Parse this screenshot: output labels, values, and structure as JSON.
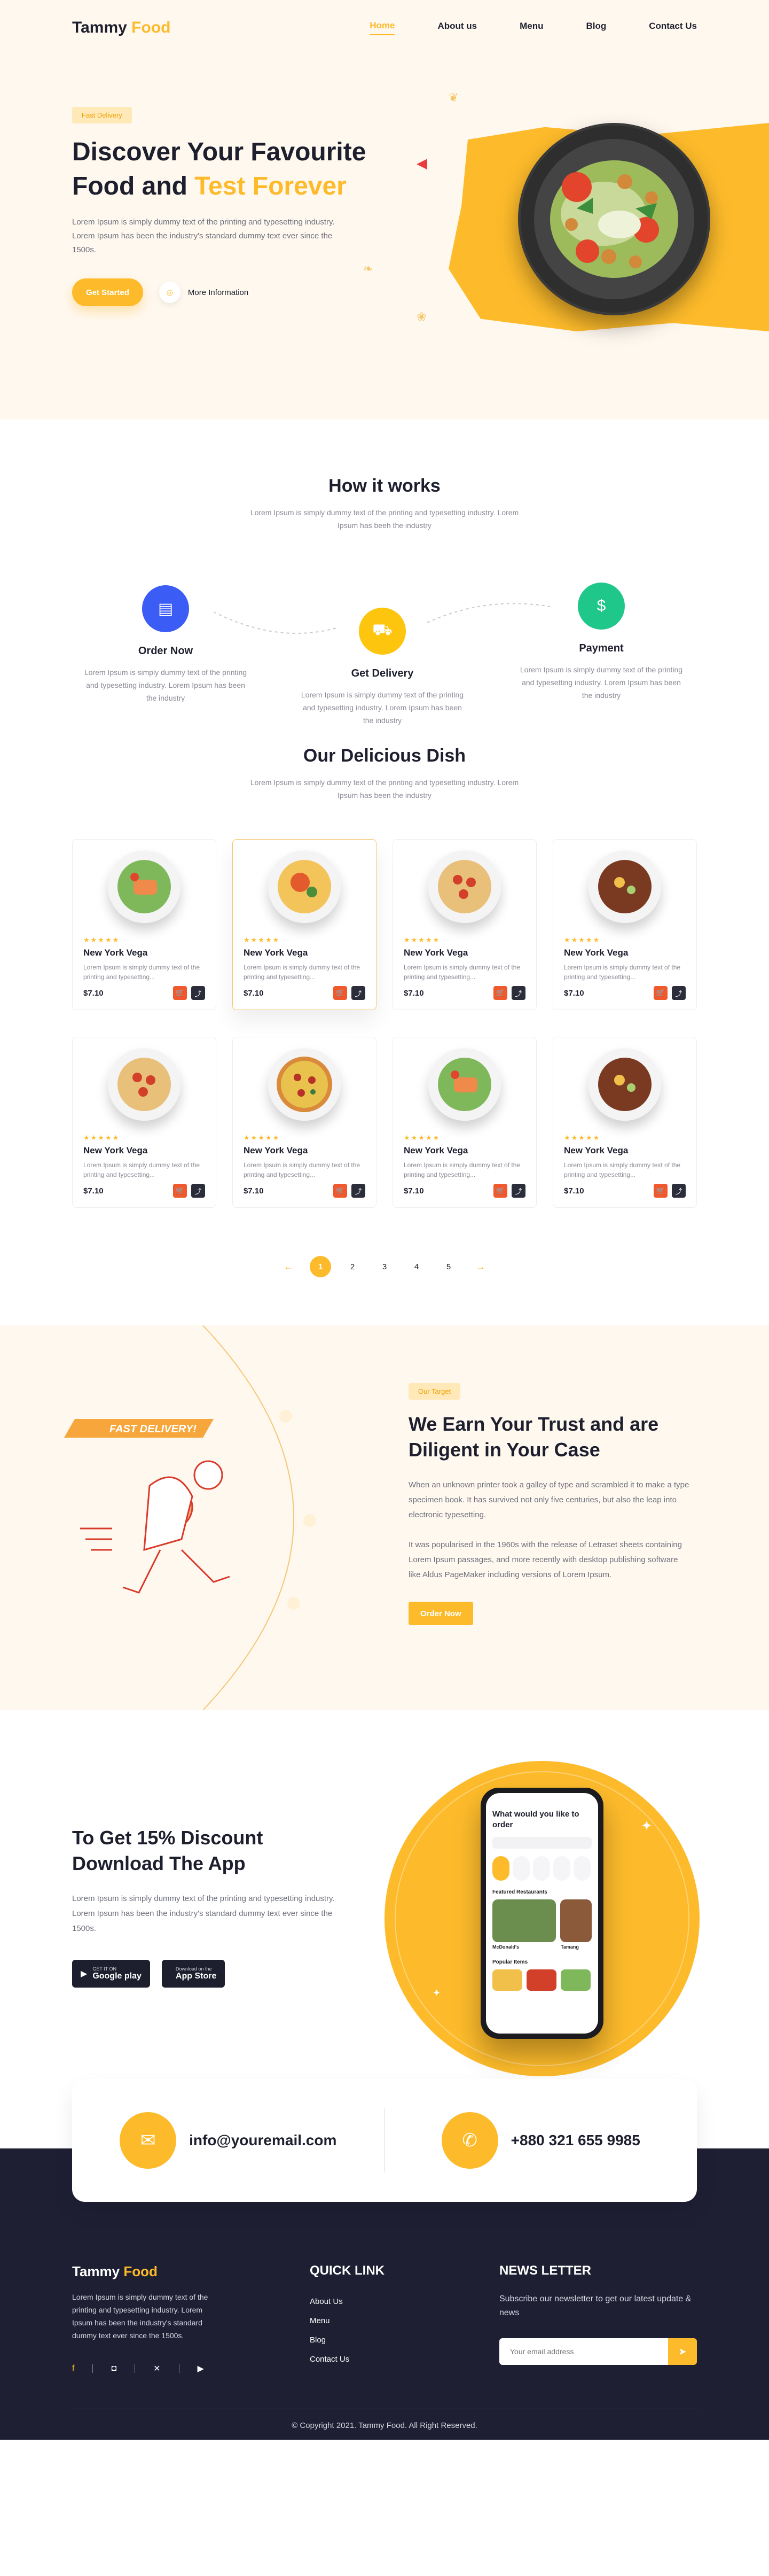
{
  "header": {
    "logo_main": "Tammy",
    "logo_accent": "Food",
    "nav": [
      {
        "label": "Home",
        "active": true
      },
      {
        "label": "About us",
        "active": false
      },
      {
        "label": "Menu",
        "active": false
      },
      {
        "label": "Blog",
        "active": false
      },
      {
        "label": "Contact Us",
        "active": false
      }
    ]
  },
  "hero": {
    "badge": "Fast Delivery",
    "title_line1": "Discover Your Favourite",
    "title_line2_main": "Food and ",
    "title_line2_accent": "Test Forever",
    "text": "Lorem Ipsum is simply dummy text of the printing and typesetting industry. Lorem Ipsum has been the industry's standard dummy text ever since the 1500s.",
    "cta": "Get Started",
    "more": "More Information"
  },
  "how": {
    "title": "How it works",
    "subtitle": "Lorem Ipsum is simply dummy text of the printing and typesetting industry. Lorem Ipsum has beeh the industry",
    "steps": [
      {
        "title": "Order Now",
        "text": "Lorem Ipsum is simply dummy text of the printing and typesetting industry. Lorem Ipsum has been the industry",
        "color": "#3b5cf5",
        "icon": "document-icon"
      },
      {
        "title": "Get Delivery",
        "text": "Lorem Ipsum is simply dummy text of the printing and typesetting industry. Lorem Ipsum has been the industry",
        "color": "#fdc50e",
        "icon": "truck-icon"
      },
      {
        "title": "Payment",
        "text": "Lorem Ipsum is simply dummy text of the printing and typesetting industry. Lorem Ipsum has been the industry",
        "color": "#1fc88a",
        "icon": "dollar-icon"
      }
    ]
  },
  "dish": {
    "title": "Our Delicious Dish",
    "subtitle": "Lorem Ipsum is simply dummy text of the printing and typesetting industry. Lorem Ipsum has been the industry",
    "cards": [
      {
        "name": "New York Vega",
        "desc": "Lorem Ipsum is simply dummy text of the printing and typesetting...",
        "price": "$7.10",
        "rating": 5
      },
      {
        "name": "New York Vega",
        "desc": "Lorem Ipsum is simply dummy text of the printing and typesetting...",
        "price": "$7.10",
        "rating": 5
      },
      {
        "name": "New York Vega",
        "desc": "Lorem Ipsum is simply dummy text of the printing and typesetting...",
        "price": "$7.10",
        "rating": 5
      },
      {
        "name": "New York Vega",
        "desc": "Lorem Ipsum is simply dummy text of the printing and typesetting...",
        "price": "$7.10",
        "rating": 5
      },
      {
        "name": "New York Vega",
        "desc": "Lorem Ipsum is simply dummy text of the printing and typesetting...",
        "price": "$7.10",
        "rating": 5
      },
      {
        "name": "New York Vega",
        "desc": "Lorem Ipsum is simply dummy text of the printing and typesetting...",
        "price": "$7.10",
        "rating": 5
      },
      {
        "name": "New York Vega",
        "desc": "Lorem Ipsum is simply dummy text of the printing and typesetting...",
        "price": "$7.10",
        "rating": 5
      },
      {
        "name": "New York Vega",
        "desc": "Lorem Ipsum is simply dummy text of the printing and typesetting...",
        "price": "$7.10",
        "rating": 5
      }
    ],
    "pages": [
      "1",
      "2",
      "3",
      "4",
      "5"
    ],
    "current_page": "1"
  },
  "trust": {
    "badge": "Our Target",
    "title": "We Earn Your Trust and are Diligent in Your Case",
    "p1": "When an unknown printer took a galley of type and scrambled it to make a type specimen book. It has survived not only five centuries, but also the leap into electronic typesetting.",
    "p2": "It was popularised in the 1960s with the release of Letraset sheets containing Lorem Ipsum passages, and more recently with desktop publishing software like Aldus PageMaker including versions of Lorem Ipsum.",
    "cta": "Order Now",
    "illus_label": "FAST DELIVERY!"
  },
  "app": {
    "title": "To Get 15% Discount Download The App",
    "text": "Lorem Ipsum is simply dummy text of the printing and typesetting industry. Lorem Ipsum has been the industry's standard dummy text ever since the 1500s.",
    "google_small": "GET IT ON",
    "google": "Google play",
    "apple_small": "Download on the",
    "apple": "App Store",
    "phone_title": "What would you like to order",
    "phone_section1": "Featured Restaurants",
    "phone_item1": "McDonald's",
    "phone_item2": "Tamang",
    "phone_section2": "Popular Items"
  },
  "contact": {
    "email": "info@youremail.com",
    "phone": "+880 321 655 9985"
  },
  "footer": {
    "logo_main": "Tammy",
    "logo_accent": "Food",
    "text": "Lorem Ipsum is simply dummy text of the printing and typesetting industry. Lorem Ipsum has been the industry's standard dummy text ever since the 1500s.",
    "quick_title": "QUICK LINK",
    "links": [
      "About Us",
      "Menu",
      "Blog",
      "Contact Us"
    ],
    "news_title": "NEWS LETTER",
    "news_text": "Subscribe our newsletter to get our latest update & news",
    "news_placeholder": "Your email address",
    "copyright": "Copyright 2021. Tammy Food. All Right Reserved."
  },
  "colors": {
    "accent": "#fdbb2b",
    "dark": "#1e1f33",
    "cream": "#fff8ef",
    "red": "#f0592d"
  }
}
